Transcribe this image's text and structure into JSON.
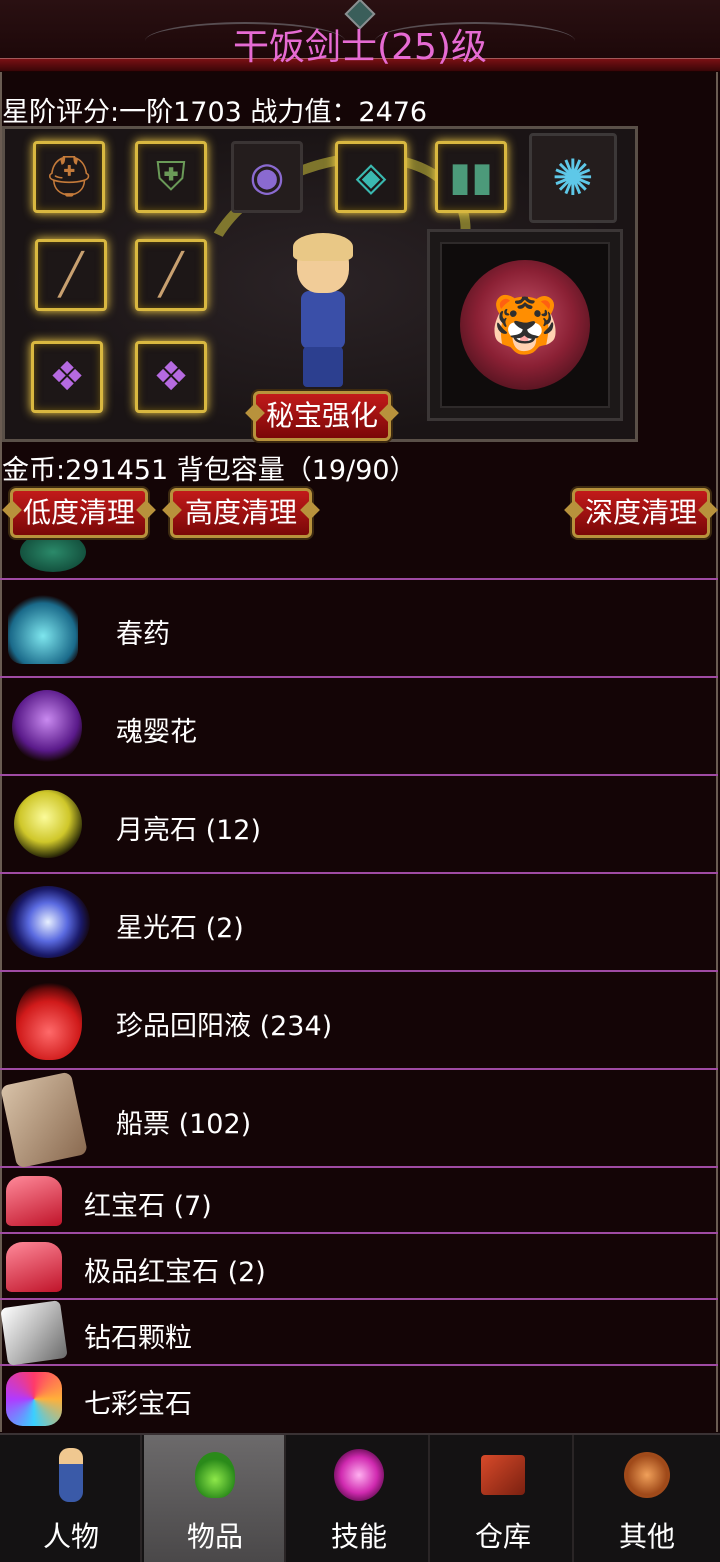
{
  "header": {
    "title": "干饭剑士(25)级"
  },
  "stats": {
    "rating_line": "星阶评分:一阶1703 战力值：2476"
  },
  "equipment": {
    "button_label": "秘宝强化",
    "slot_icons": [
      "helmet-icon",
      "armor-icon",
      "necklace-icon",
      "bracer-icon",
      "boots-icon",
      "wolf-pet-icon",
      "sword-icon",
      "sword-icon",
      "ring-icon",
      "ring-icon"
    ],
    "mount_icon": "tiger-icon"
  },
  "bag": {
    "info_line": "金币:291451 背包容量（19/90）",
    "buttons": {
      "low": "低度清理",
      "high": "高度清理",
      "deep": "深度清理"
    }
  },
  "items": [
    {
      "name": "春药",
      "icon": "potion-bottle-icon"
    },
    {
      "name": "魂婴花",
      "icon": "flower-icon"
    },
    {
      "name": "月亮石 (12)",
      "icon": "moonstone-icon"
    },
    {
      "name": "星光石 (2)",
      "icon": "starstone-icon"
    },
    {
      "name": "珍品回阳液 (234)",
      "icon": "red-flask-icon"
    },
    {
      "name": "船票 (102)",
      "icon": "scroll-ticket-icon"
    },
    {
      "name": "红宝石 (7)",
      "icon": "ruby-icon"
    },
    {
      "name": "极品红宝石 (2)",
      "icon": "ruby-icon"
    },
    {
      "name": "钻石颗粒",
      "icon": "diamond-icon"
    },
    {
      "name": "七彩宝石",
      "icon": "rainbow-gem-icon"
    }
  ],
  "nav": [
    {
      "label": "人物",
      "icon": "character-icon"
    },
    {
      "label": "物品",
      "icon": "potion-icon",
      "active": true
    },
    {
      "label": "技能",
      "icon": "skill-orb-icon"
    },
    {
      "label": "仓库",
      "icon": "warehouse-icon"
    },
    {
      "label": "其他",
      "icon": "sword-shield-icon"
    }
  ]
}
